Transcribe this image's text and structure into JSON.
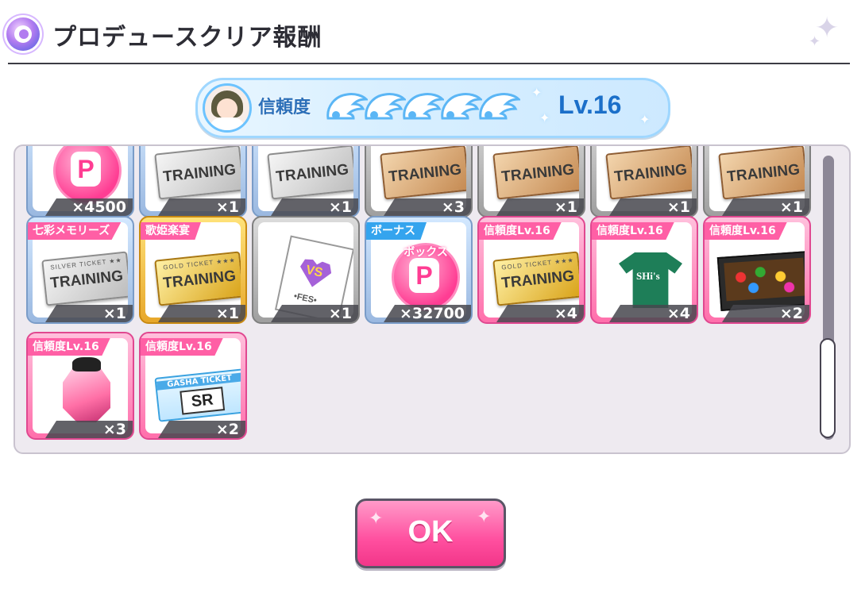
{
  "header": {
    "title": "プロデュースクリア報酬",
    "icon": "producer-emblem-icon"
  },
  "trust": {
    "label": "信頼度",
    "wings": 5,
    "level": "Lv.16",
    "icon": "wing-icon"
  },
  "items_row0": [
    {
      "count": "×4500",
      "kind": "coin"
    },
    {
      "count": "×1",
      "kind": "silver-ticket",
      "ticket_text": "TRAINING"
    },
    {
      "count": "×1",
      "kind": "silver-ticket",
      "ticket_text": "TRAINING"
    },
    {
      "count": "×3",
      "kind": "bronze-ticket",
      "ticket_text": "TRAINING"
    },
    {
      "count": "×1",
      "kind": "bronze-ticket",
      "ticket_text": "TRAINING"
    },
    {
      "count": "×1",
      "kind": "bronze-ticket",
      "ticket_text": "TRAINING"
    },
    {
      "count": "×1",
      "kind": "bronze-ticket",
      "ticket_text": "TRAINING"
    }
  ],
  "items_row1": [
    {
      "tag": "七彩メモリーズ",
      "count": "×1",
      "kind": "silver-ticket",
      "ticket_text": "TRAINING",
      "ticket_small": "SILVER TICKET ★★"
    },
    {
      "tag": "歌姫楽宴",
      "count": "×1",
      "kind": "gold-ticket",
      "ticket_text": "TRAINING",
      "ticket_small": "GOLD TICKET ★★★"
    },
    {
      "tag": "",
      "count": "×1",
      "kind": "fes-card",
      "vs": "VS",
      "fes": "•FES•"
    },
    {
      "tag": "ボーナス",
      "count": "×32700",
      "kind": "coin",
      "coin_label": "ボックス"
    },
    {
      "tag": "信頼度Lv.16",
      "count": "×4",
      "kind": "gold-ticket",
      "ticket_text": "TRAINING",
      "ticket_small": "GOLD TICKET ★★★"
    },
    {
      "tag": "信頼度Lv.16",
      "count": "×4",
      "kind": "shirt",
      "logo": "SHi's"
    },
    {
      "tag": "信頼度Lv.16",
      "count": "×2",
      "kind": "gift-box"
    }
  ],
  "items_row2": [
    {
      "tag": "信頼度Lv.16",
      "count": "×3",
      "kind": "gem"
    },
    {
      "tag": "信頼度Lv.16",
      "count": "×2",
      "kind": "gasha-ticket",
      "gasha_label": "GASHA TICKET",
      "rarity": "SR"
    }
  ],
  "ok_button": {
    "label": "OK"
  },
  "colors": {
    "accent_pink": "#ff4f9f",
    "trust_blue": "#1b6fc9",
    "panel_bg": "#eeeaf0"
  }
}
